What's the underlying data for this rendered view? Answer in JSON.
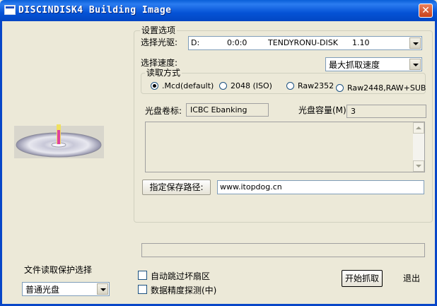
{
  "window": {
    "title": "DISCINDISK4 Building Image",
    "close_label": "✕"
  },
  "settings": {
    "group_label": "设置选项",
    "drive_label": "选择光驱:",
    "drive_value": {
      "letter": "D:",
      "id": "0:0:0",
      "model": "TENDYRONU-DISK",
      "rev": "1.10"
    },
    "speed_label": "选择速度:",
    "speed_value": "最大抓取速度",
    "read_mode": {
      "group_label": "读取方式",
      "options": [
        ".Mcd(default)",
        "2048 (ISO)",
        "Raw2352",
        "Raw2448,RAW+SUB"
      ],
      "selected": ".Mcd(default)"
    },
    "volume_label": "光盘卷标:",
    "volume_value": "ICBC Ebanking",
    "capacity_label": "光盘容量(M):",
    "capacity_value": "3",
    "path_button": "指定保存路径:",
    "path_value": "www.itopdog.cn"
  },
  "protect": {
    "label": "文件读取保护选择",
    "value": "普通光盘"
  },
  "options": {
    "skip_bad": "自动跳过坏扇区",
    "precision": "数据精度探测(中)"
  },
  "actions": {
    "start": "开始抓取",
    "exit": "退出"
  },
  "colors": {
    "titlebar": "#0553d6",
    "face": "#ece9d8",
    "close": "#c8401a"
  }
}
